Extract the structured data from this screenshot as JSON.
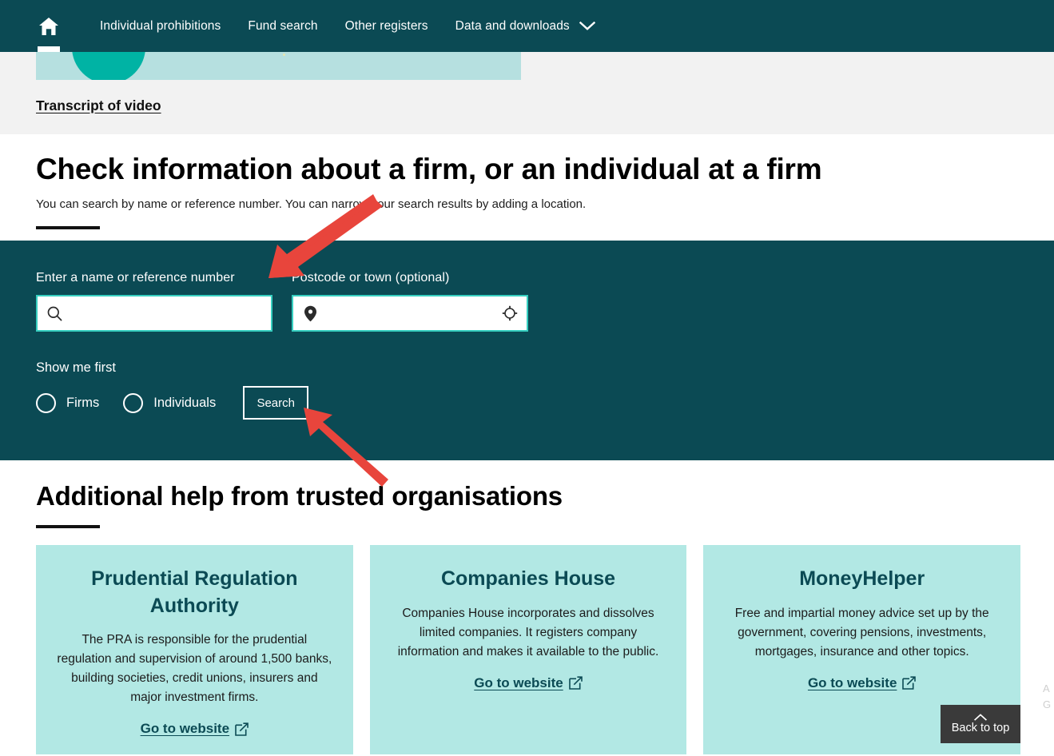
{
  "nav": {
    "home_icon": "home-icon",
    "links": [
      {
        "label": "Individual prohibitions",
        "caret": false
      },
      {
        "label": "Fund search",
        "caret": false
      },
      {
        "label": "Other registers",
        "caret": false
      },
      {
        "label": "Data and downloads",
        "caret": true
      }
    ]
  },
  "video": {
    "transcript_link": "Transcript of video"
  },
  "intro": {
    "heading": "Check information about a firm, or an individual at a firm",
    "subheading": "You can search by name or reference number. You can narrow your search results by adding a location."
  },
  "search": {
    "name_label": "Enter a name or reference number",
    "name_value": "",
    "name_placeholder": "",
    "name_icon": "search-icon",
    "postcode_label": "Postcode or town (optional)",
    "postcode_value": "",
    "postcode_placeholder": "",
    "postcode_icon": "map-pin-icon",
    "geolocate_icon": "crosshair-icon",
    "show_me_first_label": "Show me first",
    "options": [
      {
        "label": "Firms",
        "selected": false
      },
      {
        "label": "Individuals",
        "selected": false
      }
    ],
    "submit_label": "Search"
  },
  "help": {
    "heading": "Additional help from trusted organisations",
    "cards": [
      {
        "title": "Prudential Regulation Authority",
        "body": "The PRA is responsible for the prudential regulation and supervision of around 1,500 banks, building societies, credit unions, insurers and major investment firms.",
        "link_label": "Go to website",
        "link_icon": "external-link-icon"
      },
      {
        "title": "Companies House",
        "body": "Companies House incorporates and dissolves limited companies. It registers company information and makes it available to the public.",
        "link_label": "Go to website",
        "link_icon": "external-link-icon"
      },
      {
        "title": "MoneyHelper",
        "body": "Free and impartial money advice set up by the government, covering pensions, investments, mortgages, insurance and other topics.",
        "link_label": "Go to website",
        "link_icon": "external-link-icon"
      }
    ]
  },
  "back_to_top": {
    "label": "Back to top",
    "icon": "chevron-up-icon"
  },
  "edge_clip": {
    "line1": "A",
    "line2": "G"
  },
  "colors": {
    "brand_dark_teal": "#0b4a54",
    "accent_teal": "#36cfc0",
    "card_bg": "#b2e8e4",
    "band_bg": "#f2f2f2",
    "annotation_red": "#e8453c",
    "back_to_top_bg": "#3a3a3a"
  }
}
